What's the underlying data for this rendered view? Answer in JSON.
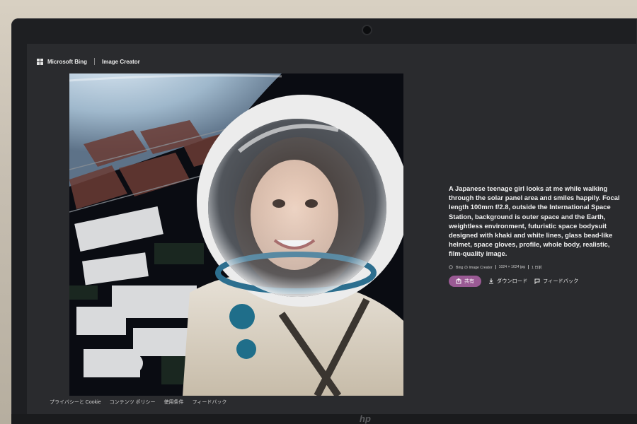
{
  "header": {
    "brand": "Microsoft Bing",
    "product": "Image Creator"
  },
  "image": {
    "alt": "Generated image: astronaut girl on space station with Earth in background"
  },
  "details": {
    "prompt": "A Japanese teenage girl looks at me while walking through the solar panel area and smiles happily. Focal length 100mm f/2.8, outside the International Space Station, background is outer space and the Earth, weightless environment, futuristic space bodysuit designed with khaki and white lines, glass bead-like helmet, space gloves, profile, whole body, realistic, film-quality image.",
    "source": "Bing の Image Creator",
    "size": "1024 × 1024 jpg",
    "age": "1 日前",
    "share_label": "共有",
    "download_label": "ダウンロード",
    "feedback_label": "フィードバック"
  },
  "footer": {
    "links": [
      "プライバシーと Cookie",
      "コンテンツ ポリシー",
      "使用条件",
      "フィードバック"
    ]
  },
  "device": {
    "logo": "hp"
  },
  "colors": {
    "share_button": "#9a5a94",
    "screen_bg": "#2a2b2e"
  }
}
